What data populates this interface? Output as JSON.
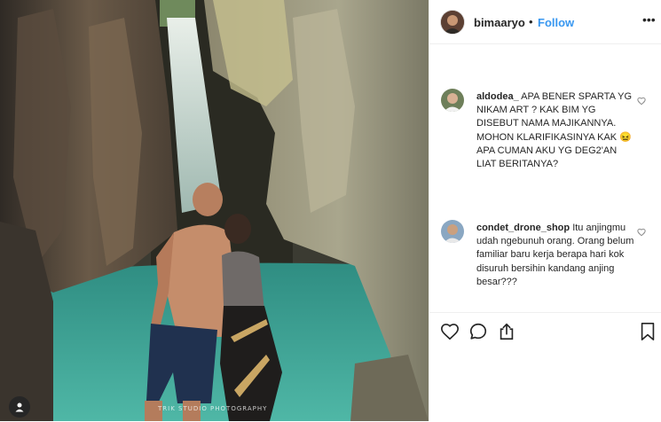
{
  "post": {
    "username": "bimaaryo",
    "separator": "•",
    "follow_label": "Follow",
    "more_label": "•••",
    "watermark": "TRIK STUDIO PHOTOGRAPHY"
  },
  "comments": [
    {
      "username": "aldodea_",
      "text_before_emoji": "APA BENER SPARTA YG NIKAM ART ? KAK BIM YG DISEBUT NAMA MAJIKANNYA. MOHON KLARIFIKASINYA KAK",
      "emoji": "😖",
      "text_after_emoji": "APA CUMAN AKU YG DEG2'AN LIAT BERITANYA?"
    },
    {
      "username": "condet_drone_shop",
      "text_before_emoji": "Itu anjingmu udah ngebunuh orang. Orang belum familiar baru kerja berapa hari kok disuruh bersihin kandang anjing besar???",
      "emoji": "",
      "text_after_emoji": ""
    }
  ],
  "icons": [
    "user-tag-icon",
    "more-options-icon",
    "heart-icon",
    "comment-icon",
    "share-icon",
    "bookmark-icon"
  ]
}
